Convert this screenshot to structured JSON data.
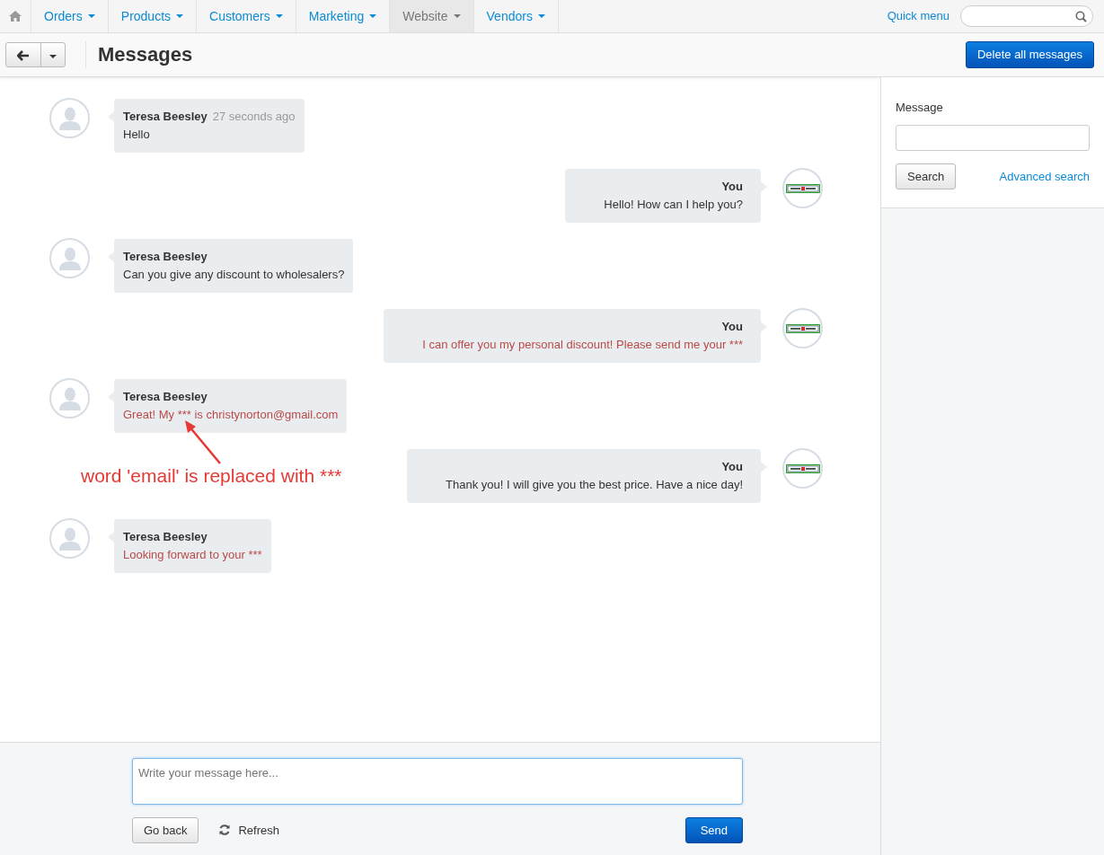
{
  "top_menu": [
    {
      "label": "Orders",
      "selected": false
    },
    {
      "label": "Products",
      "selected": false
    },
    {
      "label": "Customers",
      "selected": false
    },
    {
      "label": "Marketing",
      "selected": false
    },
    {
      "label": "Website",
      "selected": true
    },
    {
      "label": "Vendors",
      "selected": false
    }
  ],
  "quick_menu": "Quick menu",
  "page_title": "Messages",
  "delete_button": "Delete all messages",
  "messages": [
    {
      "kind": "customer",
      "author": "Teresa Beesley",
      "time": "27 seconds ago",
      "text": "Hello",
      "flagged": false
    },
    {
      "kind": "you",
      "author": "You",
      "text": "Hello! How can I help you?",
      "flagged": false
    },
    {
      "kind": "customer",
      "author": "Teresa Beesley",
      "text": "Can you give any discount to wholesalers?",
      "flagged": false
    },
    {
      "kind": "you",
      "author": "You",
      "text": "I can offer you my personal discount! Please send me your ***",
      "flagged": true
    },
    {
      "kind": "customer",
      "author": "Teresa Beesley",
      "text": "Great! My *** is christynorton@gmail.com",
      "flagged": true
    },
    {
      "kind": "you",
      "author": "You",
      "text": "Thank you! I will give you the best price. Have a nice day!",
      "flagged": false
    },
    {
      "kind": "customer",
      "author": "Teresa Beesley",
      "text": "Looking forward to your ***",
      "flagged": true
    }
  ],
  "annotation": "word 'email' is replaced with ***",
  "composer": {
    "placeholder": "Write your message here...",
    "go_back": "Go back",
    "refresh": "Refresh",
    "send": "Send"
  },
  "sidebar": {
    "label": "Message",
    "search_button": "Search",
    "advanced_search": "Advanced search"
  }
}
